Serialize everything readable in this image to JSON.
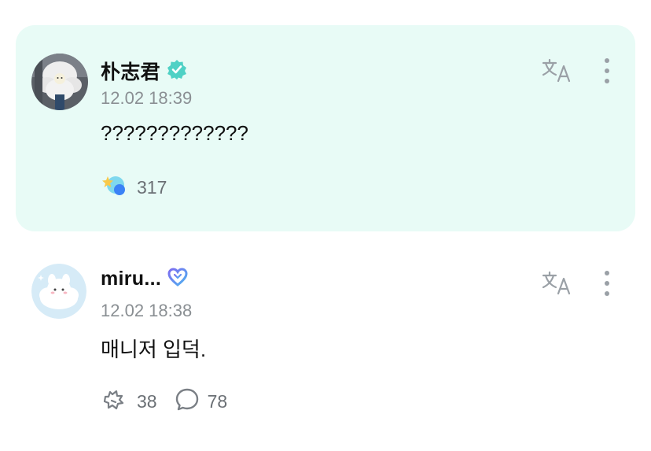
{
  "posts": [
    {
      "author": "朴志君",
      "verified": "verified-badge-icon",
      "time": "12.02 18:39",
      "text": "?????????????",
      "reaction_count": "317",
      "highlighted": true
    },
    {
      "author": "miru...",
      "badge": "heart-badge-icon",
      "time": "12.02 18:38",
      "text": "매니저 입덕.",
      "like_count": "38",
      "comment_count": "78",
      "highlighted": false
    }
  ],
  "icons": {
    "translate": "translate-icon",
    "more": "more-vertical-icon",
    "like": "like-outline-icon",
    "comment": "comment-icon",
    "reaction": "star-reaction-icon"
  },
  "colors": {
    "highlight_bg": "#e8fbf6",
    "verified": "#4fd1c5",
    "muted": "#8a8f93"
  }
}
